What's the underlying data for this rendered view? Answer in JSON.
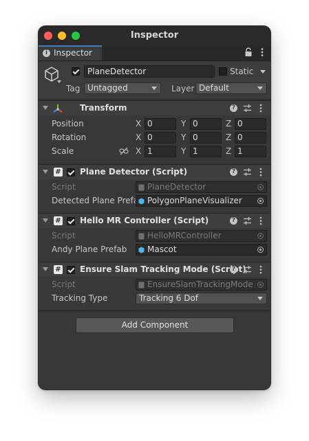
{
  "window": {
    "title": "Inspector"
  },
  "tab": {
    "label": "Inspector"
  },
  "gameobject": {
    "name": "PlaneDetector",
    "static_label": "Static",
    "tag_label": "Tag",
    "tag_value": "Untagged",
    "layer_label": "Layer",
    "layer_value": "Default"
  },
  "transform": {
    "title": "Transform",
    "rows": [
      {
        "label": "Position",
        "x": "0",
        "y": "0",
        "z": "0"
      },
      {
        "label": "Rotation",
        "x": "0",
        "y": "0",
        "z": "0"
      },
      {
        "label": "Scale",
        "x": "1",
        "y": "1",
        "z": "1"
      }
    ],
    "axis_labels": [
      "X",
      "Y",
      "Z"
    ]
  },
  "plane_detector": {
    "title": "Plane Detector (Script)",
    "script_label": "Script",
    "script_value": "PlaneDetector",
    "field_label": "Detected Plane Prefa",
    "field_value": "PolygonPlaneVisualizer"
  },
  "hello_mr": {
    "title": "Hello MR Controller (Script)",
    "script_label": "Script",
    "script_value": "HelloMRController",
    "field_label": "Andy Plane Prefab",
    "field_value": "Mascot"
  },
  "slam": {
    "title": "Ensure Slam Tracking Mode (Script)",
    "script_label": "Script",
    "script_value": "EnsureSlamTrackingMode",
    "field_label": "Tracking Type",
    "field_value": "Tracking 6 Dof"
  },
  "add_component": {
    "label": "Add Component"
  },
  "colors": {
    "window_bg": "#383838",
    "accent_tab": "#3a79bb",
    "close": "#ff5f57",
    "minimize": "#febc2e",
    "zoom": "#28c840",
    "prefab_icon": "#4fb3f0"
  }
}
